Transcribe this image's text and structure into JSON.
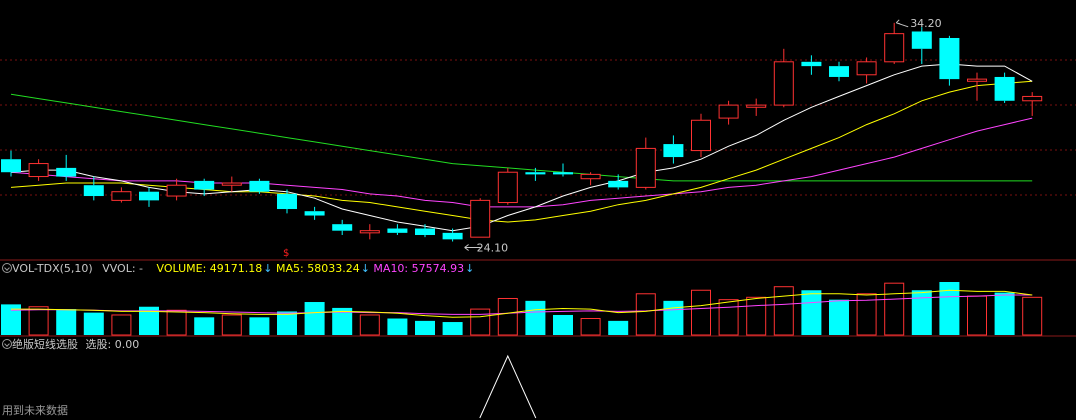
{
  "colors": {
    "up": "#ff3232",
    "down": "#00ffff",
    "ma_short": "#ffffff",
    "ma_mid": "#ffff00",
    "ma_long": "#ff44ff",
    "ma_longest": "#22dd22",
    "grid": "#7a1010",
    "signal": "#ffffff",
    "yellow": "#ffff00",
    "magenta": "#ff44ff",
    "label": "#c8c8c8"
  },
  "volume_header": {
    "name": "VOL-TDX(5,10)",
    "vvol": "VVOL: -",
    "volume": "VOLUME: 49171.18",
    "ma5": "MA5: 58033.24",
    "ma10": "MA10: 57574.93",
    "arrow": "↓"
  },
  "indicator_header": {
    "name": "绝版短线选股",
    "value": "选股: 0.00"
  },
  "footer_note": "用到未来数据",
  "chart_data": [
    {
      "type": "candlestick",
      "title": "",
      "annotations": {
        "high": "34.20",
        "low": "24.10",
        "marker": "$"
      },
      "candles": [
        {
          "o": 27.9,
          "c": 27.3,
          "h": 28.3,
          "l": 27.1
        },
        {
          "o": 27.1,
          "c": 27.7,
          "h": 27.9,
          "l": 26.9
        },
        {
          "o": 27.5,
          "c": 27.1,
          "h": 28.1,
          "l": 26.9
        },
        {
          "o": 26.7,
          "c": 26.2,
          "h": 27.1,
          "l": 26.0
        },
        {
          "o": 26.0,
          "c": 26.4,
          "h": 26.6,
          "l": 25.9
        },
        {
          "o": 26.4,
          "c": 26.0,
          "h": 26.6,
          "l": 25.7
        },
        {
          "o": 26.2,
          "c": 26.7,
          "h": 27.0,
          "l": 26.0
        },
        {
          "o": 26.9,
          "c": 26.5,
          "h": 27.0,
          "l": 26.2
        },
        {
          "o": 26.7,
          "c": 26.8,
          "h": 27.1,
          "l": 26.4
        },
        {
          "o": 26.9,
          "c": 26.4,
          "h": 27.0,
          "l": 26.3
        },
        {
          "o": 26.3,
          "c": 25.6,
          "h": 26.5,
          "l": 25.4
        },
        {
          "o": 25.5,
          "c": 25.3,
          "h": 25.7,
          "l": 25.1
        },
        {
          "o": 24.9,
          "c": 24.6,
          "h": 25.1,
          "l": 24.4
        },
        {
          "o": 24.5,
          "c": 24.6,
          "h": 24.9,
          "l": 24.2
        },
        {
          "o": 24.7,
          "c": 24.5,
          "h": 24.9,
          "l": 24.4
        },
        {
          "o": 24.7,
          "c": 24.4,
          "h": 24.9,
          "l": 24.3
        },
        {
          "o": 24.5,
          "c": 24.2,
          "h": 24.7,
          "l": 24.1
        },
        {
          "o": 24.3,
          "c": 26.0,
          "h": 26.1,
          "l": 24.3
        },
        {
          "o": 25.9,
          "c": 27.3,
          "h": 27.5,
          "l": 25.8
        },
        {
          "o": 27.3,
          "c": 27.2,
          "h": 27.5,
          "l": 26.9
        },
        {
          "o": 27.3,
          "c": 27.2,
          "h": 27.7,
          "l": 27.1
        },
        {
          "o": 27.0,
          "c": 27.2,
          "h": 27.3,
          "l": 26.7
        },
        {
          "o": 26.9,
          "c": 26.6,
          "h": 27.2,
          "l": 26.5
        },
        {
          "o": 26.6,
          "c": 28.4,
          "h": 28.9,
          "l": 26.5
        },
        {
          "o": 28.6,
          "c": 28.0,
          "h": 29.0,
          "l": 27.7
        },
        {
          "o": 28.3,
          "c": 29.7,
          "h": 30.0,
          "l": 28.0
        },
        {
          "o": 29.8,
          "c": 30.4,
          "h": 30.6,
          "l": 29.5
        },
        {
          "o": 30.3,
          "c": 30.4,
          "h": 30.7,
          "l": 29.9
        },
        {
          "o": 30.4,
          "c": 32.4,
          "h": 33.0,
          "l": 30.3
        },
        {
          "o": 32.4,
          "c": 32.2,
          "h": 32.7,
          "l": 31.8
        },
        {
          "o": 32.2,
          "c": 31.7,
          "h": 32.4,
          "l": 31.5
        },
        {
          "o": 31.8,
          "c": 32.4,
          "h": 32.6,
          "l": 31.4
        },
        {
          "o": 32.4,
          "c": 33.7,
          "h": 34.2,
          "l": 32.3
        },
        {
          "o": 33.8,
          "c": 33.0,
          "h": 34.0,
          "l": 32.3
        },
        {
          "o": 33.5,
          "c": 31.6,
          "h": 33.6,
          "l": 31.3
        },
        {
          "o": 31.5,
          "c": 31.6,
          "h": 31.9,
          "l": 30.6
        },
        {
          "o": 31.7,
          "c": 30.6,
          "h": 31.9,
          "l": 30.5
        },
        {
          "o": 30.6,
          "c": 30.8,
          "h": 31.0,
          "l": 29.9
        }
      ],
      "ma_short": [
        27.3,
        27.4,
        27.4,
        27.1,
        26.9,
        26.6,
        26.4,
        26.3,
        26.4,
        26.5,
        26.4,
        26.1,
        25.6,
        25.3,
        25.0,
        24.8,
        24.6,
        24.8,
        25.3,
        25.7,
        26.2,
        26.6,
        26.9,
        27.3,
        27.5,
        27.9,
        28.5,
        29.0,
        29.7,
        30.3,
        30.8,
        31.3,
        31.8,
        32.2,
        32.3,
        32.2,
        32.2,
        31.5
      ],
      "ma_mid": [
        26.6,
        26.7,
        26.8,
        26.8,
        26.8,
        26.7,
        26.6,
        26.5,
        26.4,
        26.4,
        26.3,
        26.2,
        26.0,
        25.9,
        25.7,
        25.5,
        25.3,
        25.1,
        25.0,
        25.1,
        25.3,
        25.5,
        25.8,
        26.0,
        26.3,
        26.6,
        27.0,
        27.4,
        27.9,
        28.4,
        28.9,
        29.5,
        30.0,
        30.6,
        31.0,
        31.3,
        31.4,
        31.5
      ],
      "ma_long": [
        27.3,
        27.2,
        27.1,
        27.0,
        26.9,
        26.9,
        26.9,
        26.8,
        26.8,
        26.8,
        26.7,
        26.6,
        26.5,
        26.3,
        26.2,
        26.0,
        25.9,
        25.7,
        25.7,
        25.7,
        25.8,
        26.0,
        26.1,
        26.2,
        26.3,
        26.4,
        26.6,
        26.7,
        26.9,
        27.1,
        27.4,
        27.7,
        28.0,
        28.4,
        28.8,
        29.2,
        29.5,
        29.8
      ],
      "ma_longest": [
        30.9,
        30.7,
        30.5,
        30.3,
        30.1,
        29.9,
        29.7,
        29.5,
        29.3,
        29.1,
        28.9,
        28.7,
        28.5,
        28.3,
        28.1,
        27.9,
        27.7,
        27.6,
        27.5,
        27.4,
        27.3,
        27.2,
        27.1,
        27.0,
        26.9,
        26.9,
        26.9,
        26.9,
        26.9,
        26.9,
        26.9,
        26.9,
        26.9,
        26.9,
        26.9,
        26.9,
        26.9,
        26.9
      ]
    },
    {
      "type": "bar",
      "title": "VOL-TDX(5,10)",
      "volume": [
        52,
        48,
        44,
        38,
        34,
        48,
        42,
        30,
        34,
        30,
        40,
        56,
        46,
        34,
        28,
        24,
        22,
        44,
        62,
        58,
        34,
        28,
        24,
        70,
        58,
        76,
        60,
        64,
        82,
        76,
        60,
        70,
        88,
        76,
        90,
        66,
        72,
        64
      ],
      "ma5": [
        44,
        44,
        43,
        42,
        40,
        40,
        39,
        38,
        36,
        35,
        35,
        38,
        40,
        39,
        37,
        33,
        30,
        31,
        37,
        43,
        45,
        44,
        38,
        40,
        46,
        50,
        56,
        62,
        66,
        70,
        70,
        68,
        70,
        72,
        76,
        74,
        74,
        68
      ],
      "ma10": [
        42,
        43,
        43,
        42,
        41,
        41,
        41,
        40,
        39,
        38,
        37,
        38,
        39,
        38,
        38,
        36,
        35,
        35,
        37,
        39,
        40,
        41,
        40,
        41,
        43,
        45,
        47,
        50,
        52,
        55,
        58,
        59,
        61,
        63,
        65,
        66,
        68,
        68
      ]
    },
    {
      "type": "line",
      "title": "绝版短线选股",
      "signal_index": 18,
      "value": 0
    }
  ]
}
